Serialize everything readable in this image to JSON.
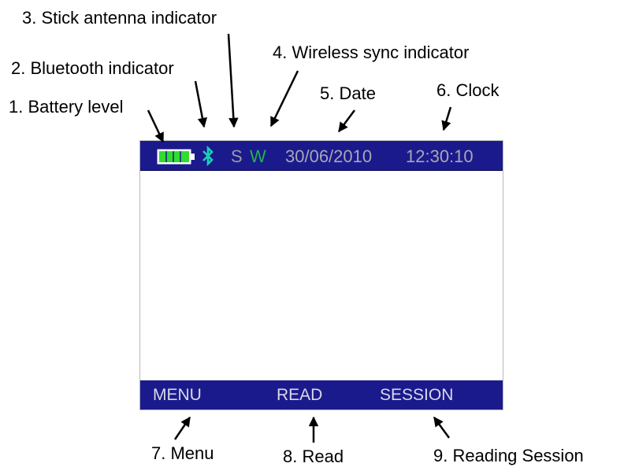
{
  "labels": {
    "battery": "1. Battery level",
    "bluetooth": "2. Bluetooth indicator",
    "stick": "3. Stick antenna indicator",
    "wireless": "4. Wireless sync indicator",
    "date": "5. Date",
    "clock": "6. Clock",
    "menu": "7. Menu",
    "read": "8. Read",
    "session": "9. Reading Session"
  },
  "status_bar": {
    "stick_indicator": "S",
    "wireless_indicator": "W",
    "date": "30/06/2010",
    "clock": "12:30:10",
    "battery_level_fraction": 1.0
  },
  "softkeys": {
    "menu": "MENU",
    "read": "READ",
    "session": "SESSION"
  },
  "colors": {
    "bar_background": "#1b1a8c",
    "battery": "#2fdc2f",
    "bluetooth": "#1bd1b8",
    "wireless": "#22b24c",
    "status_text": "#a7a7b4"
  }
}
